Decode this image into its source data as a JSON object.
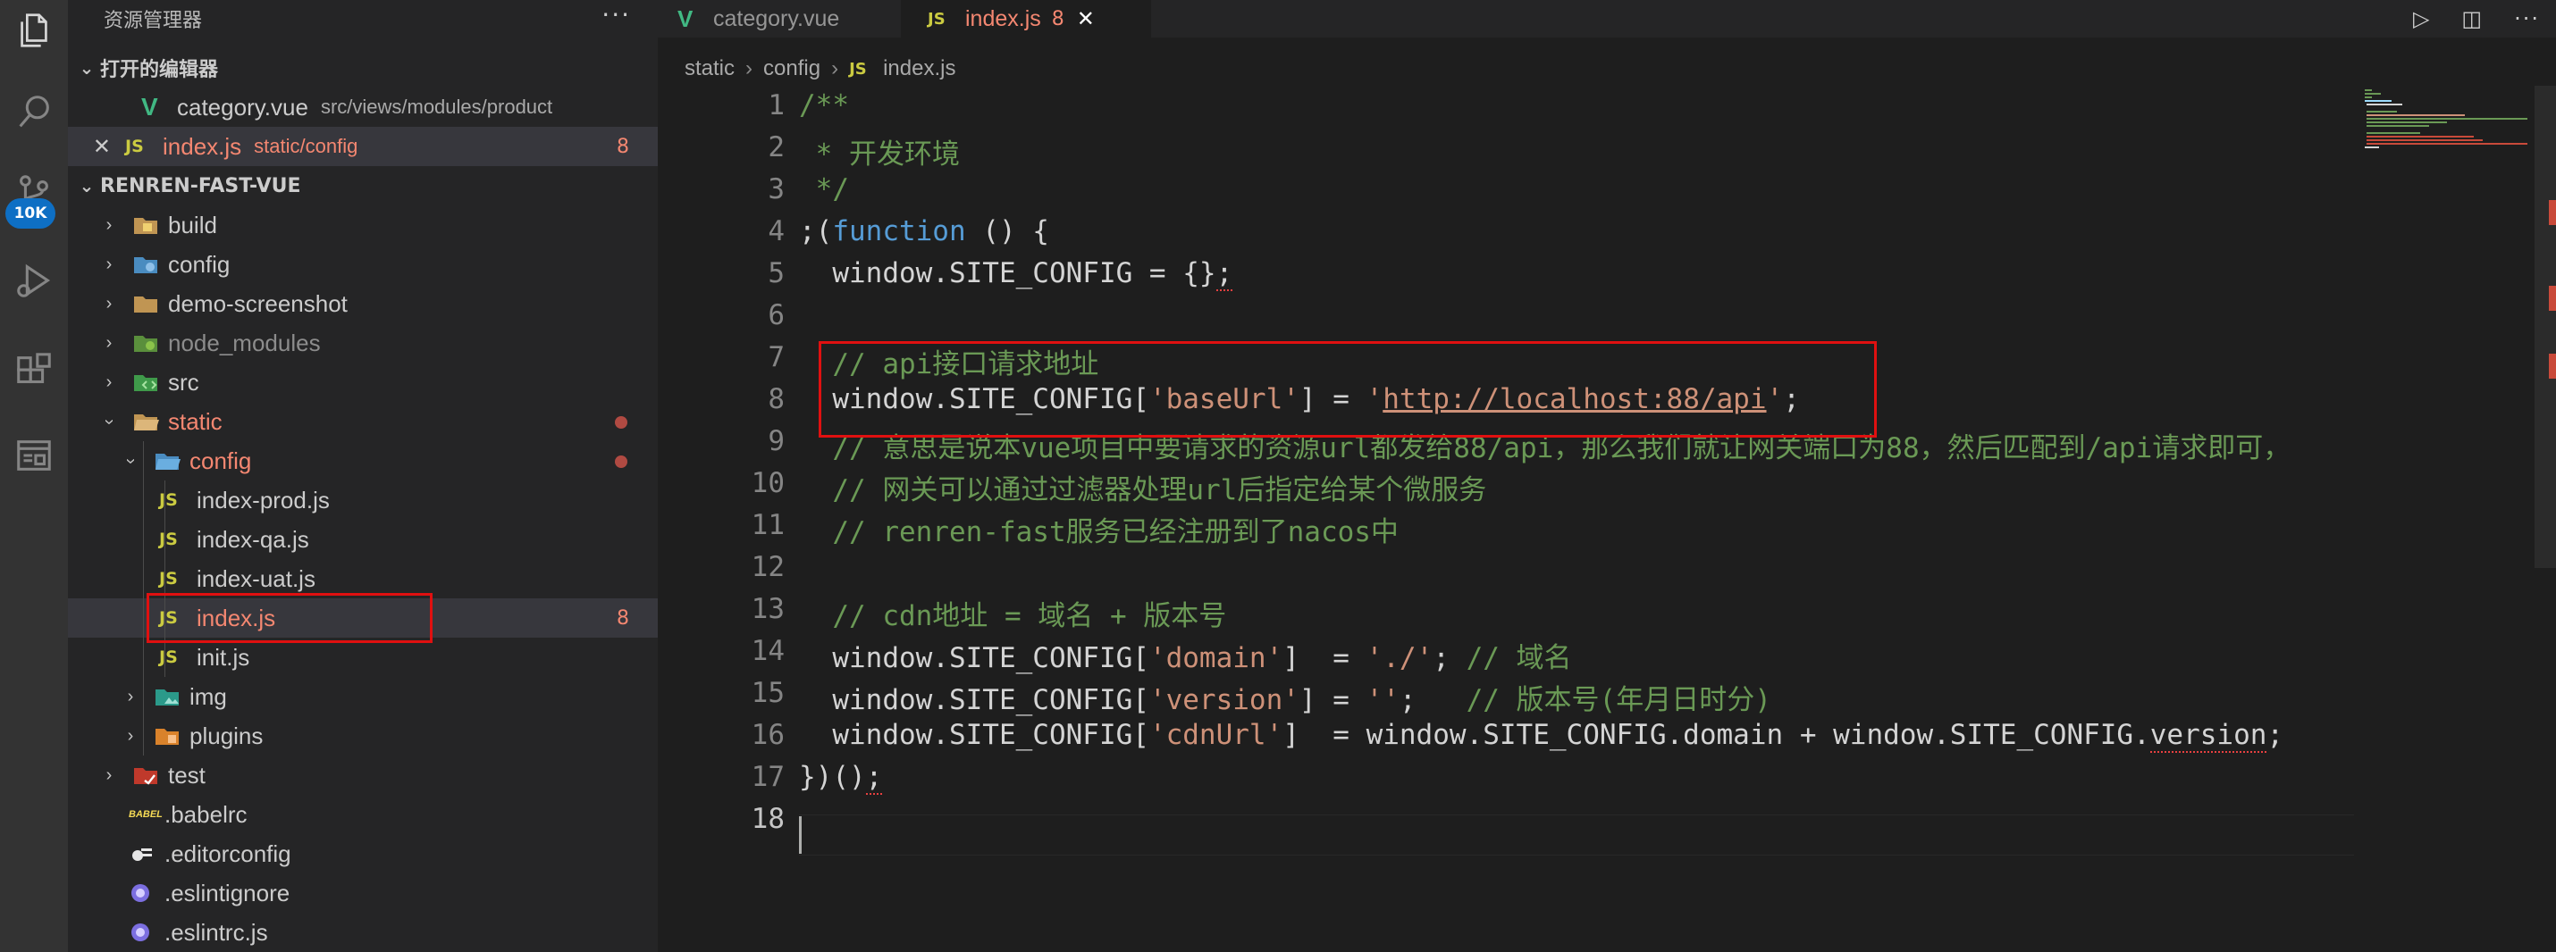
{
  "sidebar": {
    "title": "资源管理器",
    "more": "···",
    "open_editors_label": "打开的编辑器",
    "open_editors": [
      {
        "name": "category.vue",
        "path": "src/views/modules/product",
        "type": "vue"
      },
      {
        "name": "index.js",
        "path": "static/config",
        "type": "js",
        "count": "8"
      }
    ],
    "project_label": "RENREN-FAST-VUE",
    "tree": [
      {
        "name": "build",
        "type": "folder"
      },
      {
        "name": "config",
        "type": "folder"
      },
      {
        "name": "demo-screenshot",
        "type": "folder"
      },
      {
        "name": "node_modules",
        "type": "folder"
      },
      {
        "name": "src",
        "type": "folder"
      },
      {
        "name": "static",
        "type": "folder"
      },
      {
        "name": "config",
        "type": "folder"
      },
      {
        "name": "index-prod.js",
        "type": "js"
      },
      {
        "name": "index-qa.js",
        "type": "js"
      },
      {
        "name": "index-uat.js",
        "type": "js"
      },
      {
        "name": "index.js",
        "type": "js",
        "count": "8"
      },
      {
        "name": "init.js",
        "type": "js"
      },
      {
        "name": "img",
        "type": "folder"
      },
      {
        "name": "plugins",
        "type": "folder"
      },
      {
        "name": "test",
        "type": "folder"
      },
      {
        "name": ".babelrc",
        "type": "file"
      },
      {
        "name": ".editorconfig",
        "type": "file"
      },
      {
        "name": ".eslintignore",
        "type": "file"
      },
      {
        "name": ".eslintrc.js",
        "type": "file"
      }
    ]
  },
  "activity": {
    "badge": "10K"
  },
  "tabs": [
    {
      "label": "category.vue",
      "type": "vue"
    },
    {
      "label": "index.js",
      "type": "js",
      "count": "8",
      "active": true
    }
  ],
  "breadcrumb": [
    "static",
    "config",
    "index.js"
  ],
  "code_lines": [
    "1",
    "2",
    "3",
    "4",
    "5",
    "6",
    "7",
    "8",
    "9",
    "10",
    "11",
    "12",
    "13",
    "14",
    "15",
    "16",
    "17",
    "18"
  ],
  "code": {
    "l1": "/**",
    "l2": " * 开发环境",
    "l3": " */",
    "l4a": ";(",
    "l4b": "function",
    "l4c": " () {",
    "l5a": "  window.SITE_CONFIG = {}",
    "l5b": ";",
    "l7": "  // api接口请求地址",
    "l8a": "  window.SITE_CONFIG[",
    "l8b": "'baseUrl'",
    "l8c": "] = ",
    "l8d": "'",
    "l8e": "http://localhost:88/api",
    "l8f": "'",
    "l8g": ";",
    "l9": "  // 意思是说本vue项目中要请求的资源url都发给88/api，那么我们就让网关端口为88，然后匹配到/api请求即可，",
    "l10": "  // 网关可以通过过滤器处理url后指定给某个微服务",
    "l11": "  // renren-fast服务已经注册到了nacos中",
    "l13": "  // cdn地址 = 域名 + 版本号",
    "l14a": "  window.SITE_CONFIG[",
    "l14b": "'domain'",
    "l14c": "]  = ",
    "l14d": "'./'",
    "l14e": "; ",
    "l14f": "// 域名",
    "l15a": "  window.SITE_CONFIG[",
    "l15b": "'version'",
    "l15c": "] = ",
    "l15d": "''",
    "l15e": ";   ",
    "l15f": "// 版本号(年月日时分)",
    "l16a": "  window.SITE_CONFIG[",
    "l16b": "'cdnUrl'",
    "l16c": "]  = window.SITE_CONFIG.domain + window.SITE_CONFIG.",
    "l16d": "version",
    "l16e": ";",
    "l17a": "})()",
    "l17b": ";"
  }
}
